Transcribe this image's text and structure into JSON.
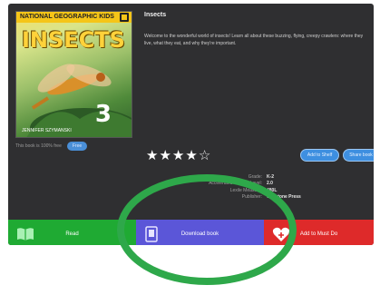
{
  "book": {
    "cover_band": "NATIONAL GEOGRAPHIC KIDS",
    "cover_title": "INSECTS",
    "cover_number": "3",
    "cover_caption": "JENNIFER SZYMANSKI",
    "title": "Insects",
    "description": "Welcome to the wonderful world of insects! Learn all about these buzzing, flying, creepy crawlers: where they live, what they eat, and why they're important."
  },
  "access": {
    "text": "This book is 100% free",
    "badge": "Free"
  },
  "rating": {
    "value": 4,
    "max": 5
  },
  "actions": {
    "add_to_shelf": "Add to Shelf",
    "share": "Share book"
  },
  "details": [
    {
      "label": "Grade:",
      "value": "K-2"
    },
    {
      "label": "Accelerated Reader Level:",
      "value": "2.0"
    },
    {
      "label": "Lexile Measure:",
      "value": "480L"
    },
    {
      "label": "Publisher:",
      "value": "Capstone Press"
    }
  ],
  "buttons": {
    "read": "Read",
    "download": "Download book",
    "favorite": "Add to Must Do"
  },
  "colors": {
    "panel": "#2f2f31",
    "read": "#1faa33",
    "download": "#5b56d8",
    "favorite": "#de2a2a",
    "annotation": "#2ea84a"
  }
}
